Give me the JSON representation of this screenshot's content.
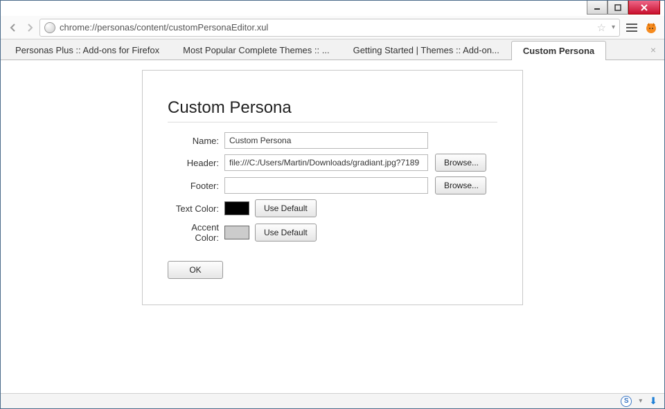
{
  "url": "chrome://personas/content/customPersonaEditor.xul",
  "tabs": [
    {
      "label": "Personas Plus :: Add-ons for Firefox"
    },
    {
      "label": "Most Popular Complete Themes :: ..."
    },
    {
      "label": "Getting Started | Themes :: Add-on..."
    },
    {
      "label": "Custom Persona"
    }
  ],
  "editor": {
    "title": "Custom Persona",
    "labels": {
      "name": "Name:",
      "header": "Header:",
      "footer": "Footer:",
      "text_color": "Text Color:",
      "accent_color": "Accent Color:"
    },
    "values": {
      "name": "Custom Persona",
      "header": "file:///C:/Users/Martin/Downloads/gradiant.jpg?7189",
      "footer": ""
    },
    "buttons": {
      "browse": "Browse...",
      "use_default": "Use Default",
      "ok": "OK"
    },
    "colors": {
      "text": "#000000",
      "accent": "#cccccc"
    }
  },
  "status": {
    "sync_letter": "S"
  }
}
